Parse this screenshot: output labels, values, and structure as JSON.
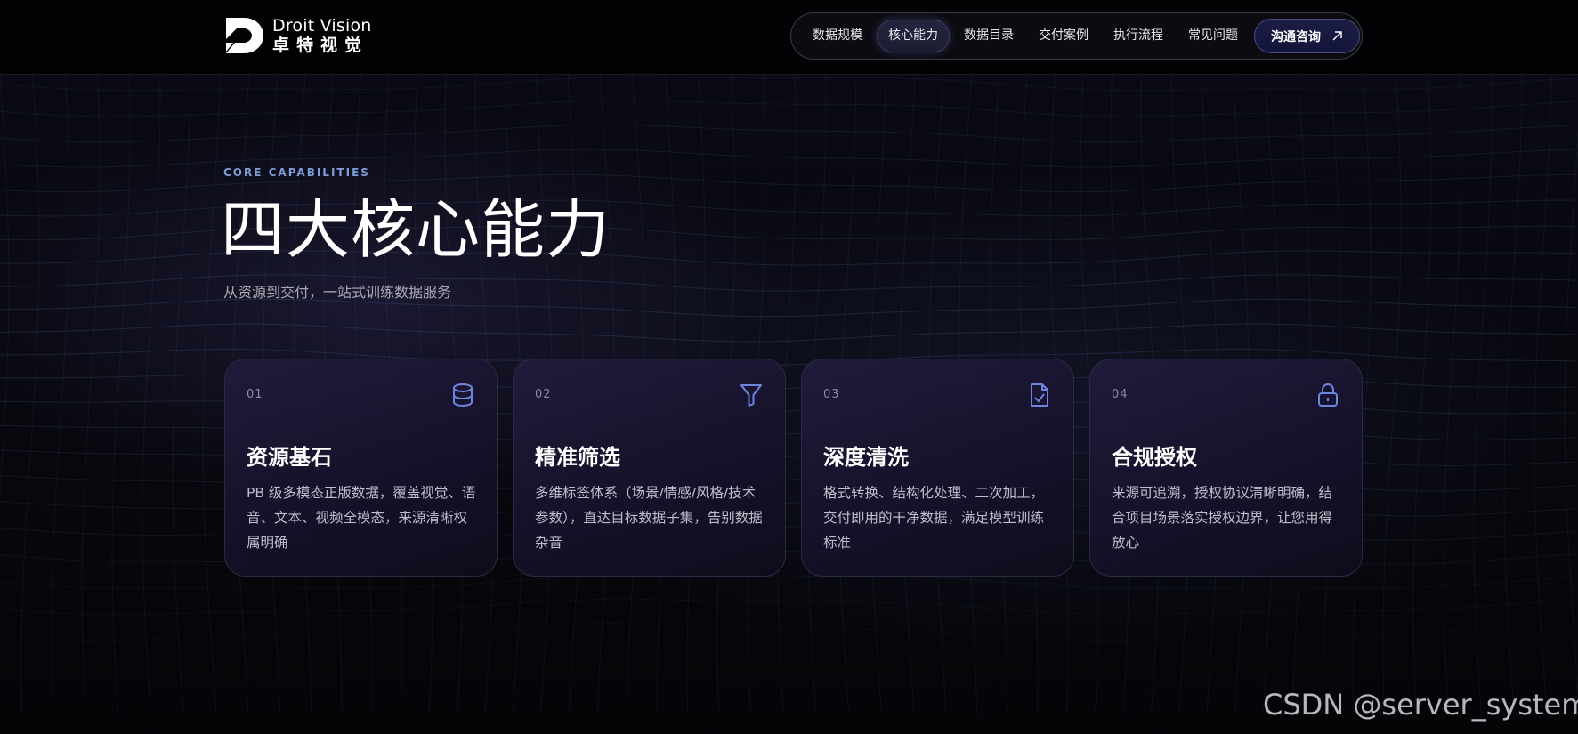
{
  "header": {
    "logo_en": "Droit Vision",
    "logo_cn": "卓特视觉",
    "nav": [
      {
        "label": "数据规模",
        "active": false
      },
      {
        "label": "核心能力",
        "active": true
      },
      {
        "label": "数据目录",
        "active": false
      },
      {
        "label": "交付案例",
        "active": false
      },
      {
        "label": "执行流程",
        "active": false
      },
      {
        "label": "常见问题",
        "active": false
      }
    ],
    "cta_label": "沟通咨询",
    "cta_icon": "arrow-up-right-icon"
  },
  "hero": {
    "eyebrow": "CORE CAPABILITIES",
    "title": "四大核心能力",
    "subtitle": "从资源到交付，一站式训练数据服务"
  },
  "cards": [
    {
      "num": "01",
      "icon": "database-icon",
      "title": "资源基石",
      "desc": "PB 级多模态正版数据，覆盖视觉、语音、文本、视频全模态，来源清晰权属明确"
    },
    {
      "num": "02",
      "icon": "filter-icon",
      "title": "精准筛选",
      "desc": "多维标签体系（场景/情感/风格/技术参数），直达目标数据子集，告别数据杂音"
    },
    {
      "num": "03",
      "icon": "file-check-icon",
      "title": "深度清洗",
      "desc": "格式转换、结构化处理、二次加工，交付即用的干净数据，满足模型训练标准"
    },
    {
      "num": "04",
      "icon": "lock-icon",
      "title": "合规授权",
      "desc": "来源可追溯，授权协议清晰明确，结合项目场景落实授权边界，让您用得放心"
    }
  ],
  "watermark": "CSDN @server_system",
  "colors": {
    "accent": "#6f86e0",
    "eyebrow": "#7f9bd8",
    "background": "#05050a"
  }
}
